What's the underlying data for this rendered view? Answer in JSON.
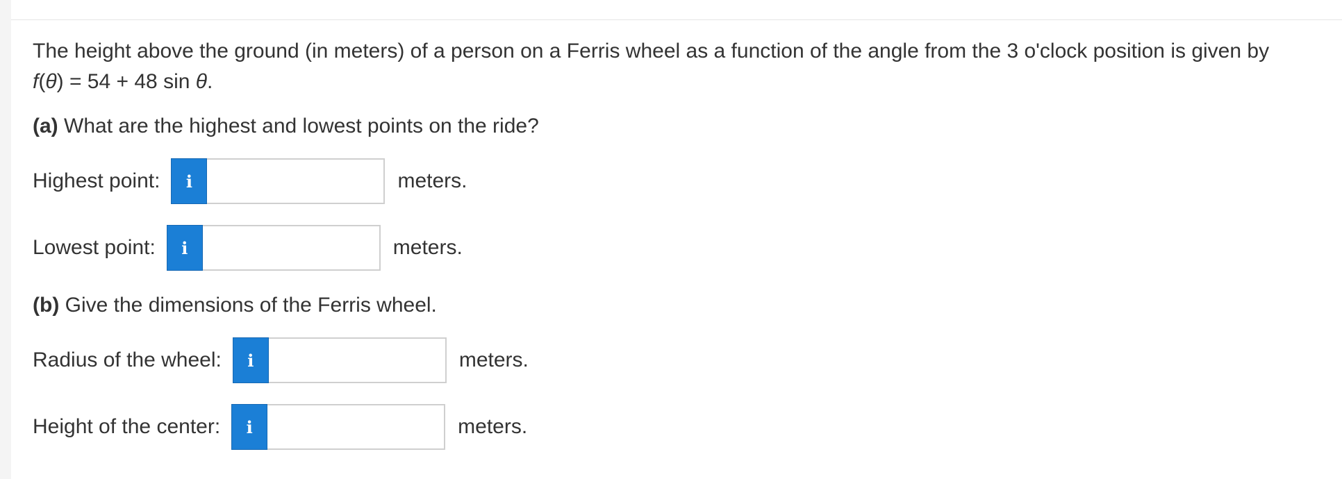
{
  "question": {
    "text": "The height above the ground (in meters) of a person on a Ferris wheel as a function of the angle from the 3 o'clock position is given by",
    "formula_fn": "f",
    "formula_open": "(",
    "formula_theta": "θ",
    "formula_mid": ") = 54 + 48 sin ",
    "formula_theta2": "θ",
    "formula_end": "."
  },
  "part_a": {
    "tag": "(a)",
    "text": " What are the highest and lowest points on the ride?",
    "rows": [
      {
        "label": "Highest point:",
        "info": "i",
        "value": "",
        "unit": "meters."
      },
      {
        "label": "Lowest point:",
        "info": "i",
        "value": "",
        "unit": "meters."
      }
    ]
  },
  "part_b": {
    "tag": "(b)",
    "text": " Give the dimensions of the Ferris wheel.",
    "rows": [
      {
        "label": "Radius of the wheel:",
        "info": "i",
        "value": "",
        "unit": "meters."
      },
      {
        "label": "Height of the center:",
        "info": "i",
        "value": "",
        "unit": "meters."
      }
    ]
  }
}
